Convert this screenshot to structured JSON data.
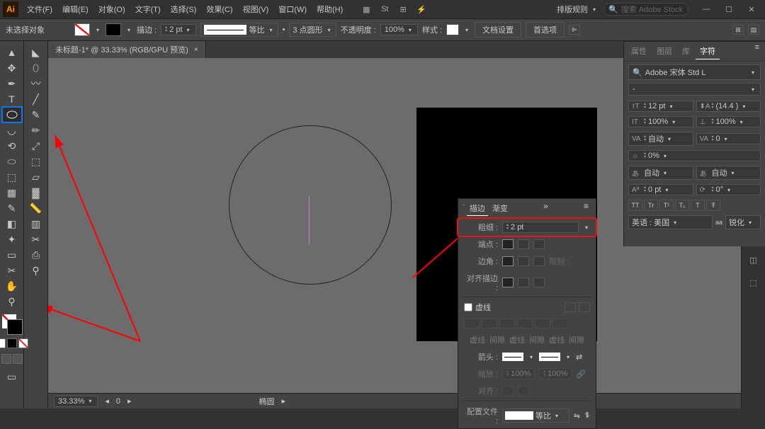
{
  "app": {
    "logo": "Ai"
  },
  "menu": [
    "文件(F)",
    "编辑(E)",
    "对象(O)",
    "文字(T)",
    "选择(S)",
    "效果(C)",
    "视图(V)",
    "窗口(W)",
    "帮助(H)"
  ],
  "titlebar": {
    "arrange": "排版规则",
    "search_placeholder": "搜索 Adobe Stock"
  },
  "options": {
    "sel_label": "未选择对象",
    "stroke_label": "描边 :",
    "stroke_val": "2 pt",
    "uniform": "等比",
    "width_profile": "3 点圆形",
    "opacity_label": "不透明度 :",
    "opacity_val": "100%",
    "style_label": "样式 :",
    "doc_setup": "文档设置",
    "prefs": "首选项"
  },
  "doc_tab": {
    "title": "未标题-1* @ 33.33% (RGB/GPU 预览)"
  },
  "status": {
    "zoom": "33.33%",
    "tool_hint": "椭圆"
  },
  "stroke_panel": {
    "tab_stroke": "描边",
    "tab_grad": "渐变",
    "weight_label": "粗细 :",
    "weight_val": "2 pt",
    "cap_label": "端点 :",
    "corner_label": "边角 :",
    "limit_label": "限制 :",
    "align_label": "对齐描边 :",
    "dashed": "虚线",
    "dash_l1": "虚线",
    "gap_l1": "间隙",
    "dash_l2": "虚线",
    "gap_l2": "间隙",
    "dash_l3": "虚线",
    "gap_l3": "间隙",
    "arrow_label": "箭头 :",
    "scale_label": "缩放 :",
    "scale_v1": "100%",
    "scale_v2": "100%",
    "alignarrow_label": "对齐 :",
    "profile_label": "配置文件 :",
    "profile_val": "等比"
  },
  "char_panel": {
    "tabs": [
      "属性",
      "图层",
      "库",
      "字符"
    ],
    "font_name": "Adobe 宋体 Std L",
    "font_style": "-",
    "size": "12 pt",
    "leading": "(14.4 )",
    "scaleh": "100%",
    "scalev": "100%",
    "kerning": "自动",
    "tracking": "0",
    "extra1": "0%",
    "extra2": "自动",
    "extra3": "自动",
    "baseline": "0 pt",
    "rotation": "0°",
    "lang": "英语 : 美国",
    "sharp": "锐化",
    "caps": [
      "TT",
      "Tr",
      "T¹",
      "T₁",
      "T",
      "Ŧ"
    ]
  },
  "tools_left": [
    "▲",
    "◣",
    "✥",
    "⬚",
    "T",
    "○",
    "◡",
    "✎",
    "▭",
    "◆",
    "⟲",
    "⬭",
    "⬚",
    "▤",
    "✂",
    "◧",
    "✧",
    "◫",
    "⊞",
    "⌖",
    "⤢",
    "✋",
    "⚲"
  ],
  "tools_left2": [
    "◤",
    "⬚",
    "✦",
    "⬚",
    "╱",
    "✎",
    "⌇",
    "⬚",
    "◴",
    "⬚",
    "⬚",
    "⬚",
    "⬚",
    "▓",
    "✂",
    "◧",
    "⬚",
    "▦",
    "⊡",
    "∅",
    "⬚",
    "⬚",
    "⚲"
  ],
  "right_icons": [
    "🎨",
    "◳",
    "〰",
    "❁",
    "✦",
    "⬚",
    "🗋",
    "☷",
    "≡",
    "◫",
    "⬚"
  ]
}
